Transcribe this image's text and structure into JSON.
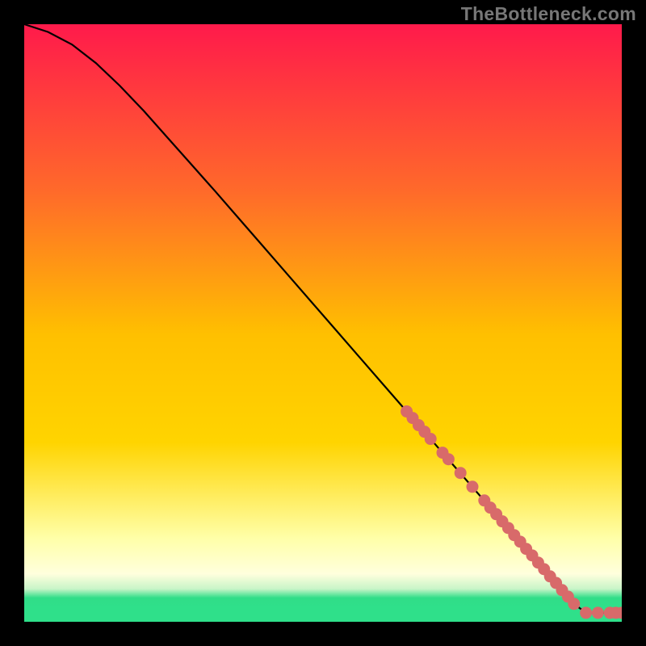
{
  "attribution": "TheBottleneck.com",
  "colors": {
    "gradient_top": "#ff1a4b",
    "gradient_mid_upper": "#ff8a2a",
    "gradient_mid": "#ffd400",
    "gradient_mid_lower": "#ffff3a",
    "gradient_low": "#ffffa0",
    "gradient_green_dark": "#1aa760",
    "gradient_green": "#2fe08a",
    "line": "#000000",
    "point": "#d86a6a",
    "frame": "#000000"
  },
  "chart_data": {
    "type": "line",
    "x": [
      0,
      4,
      8,
      12,
      16,
      20,
      24,
      28,
      32,
      36,
      40,
      44,
      48,
      52,
      56,
      60,
      64,
      68,
      72,
      76,
      78,
      80,
      82,
      84,
      85,
      86,
      88,
      90,
      92,
      94,
      96,
      98,
      100
    ],
    "values": [
      100,
      98.7,
      96.6,
      93.5,
      89.7,
      85.5,
      81.0,
      76.5,
      72.0,
      67.4,
      62.8,
      58.2,
      53.6,
      49.0,
      44.4,
      39.8,
      35.2,
      30.6,
      26.0,
      21.4,
      19.1,
      16.8,
      14.5,
      12.2,
      11.1,
      9.9,
      7.6,
      5.3,
      3.0,
      1.5,
      1.5,
      1.5,
      1.5
    ],
    "series_points": {
      "x": [
        64,
        65,
        66,
        67,
        68,
        70,
        71,
        73,
        75,
        77,
        78,
        79,
        80,
        81,
        82,
        83,
        84,
        85,
        86,
        87,
        88,
        89,
        90,
        91,
        92,
        94,
        96,
        98,
        99,
        100
      ],
      "y": [
        35.2,
        34.1,
        32.9,
        31.8,
        30.6,
        28.3,
        27.2,
        24.9,
        22.6,
        20.3,
        19.1,
        18.0,
        16.8,
        15.7,
        14.5,
        13.4,
        12.2,
        11.1,
        9.9,
        8.8,
        7.6,
        6.5,
        5.3,
        4.2,
        3.0,
        1.5,
        1.5,
        1.5,
        1.5,
        1.5
      ]
    },
    "title": "",
    "xlabel": "",
    "ylabel": "",
    "xlim": [
      0,
      100
    ],
    "ylim": [
      0,
      100
    ]
  }
}
